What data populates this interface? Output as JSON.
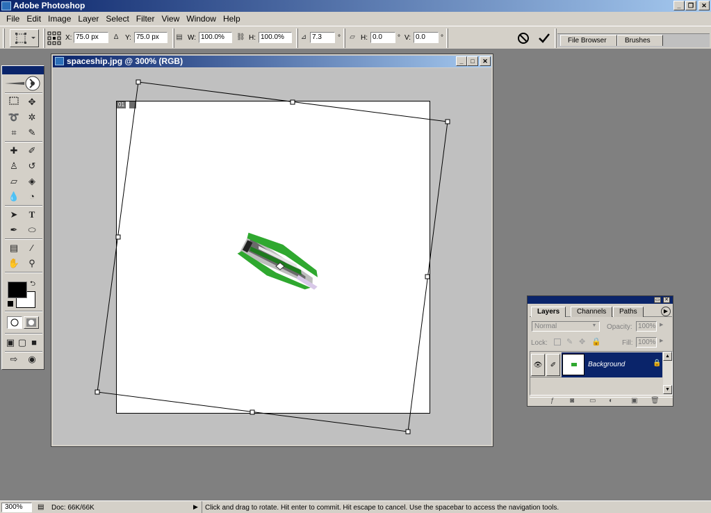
{
  "app": {
    "title": "Adobe Photoshop",
    "window_buttons": [
      "_",
      "❐",
      "✕"
    ]
  },
  "menu": [
    "File",
    "Edit",
    "Image",
    "Layer",
    "Select",
    "Filter",
    "View",
    "Window",
    "Help"
  ],
  "options": {
    "x_label": "X:",
    "x_value": "75.0 px",
    "y_label": "Y:",
    "y_value": "75.0 px",
    "w_label": "W:",
    "w_value": "100.0%",
    "h_label": "H:",
    "h_value": "100.0%",
    "angle_value": "7.3",
    "angle_unit": "°",
    "skew_h_label": "H:",
    "skew_h_value": "0.0",
    "skew_h_unit": "°",
    "skew_v_label": "V:",
    "skew_v_value": "0.0",
    "skew_v_unit": "°"
  },
  "palette_well": {
    "tabs": [
      "File Browser",
      "Brushes"
    ]
  },
  "document": {
    "title": "spaceship.jpg @ 300% (RGB)",
    "slice_label": "01"
  },
  "layers_panel": {
    "tabs": [
      "Layers",
      "Channels",
      "Paths"
    ],
    "blend_mode": "Normal",
    "opacity_label": "Opacity:",
    "opacity_value": "100%",
    "lock_label": "Lock:",
    "fill_label": "Fill:",
    "fill_value": "100%",
    "layers": [
      {
        "name": "Background"
      }
    ]
  },
  "status": {
    "zoom": "300%",
    "doc_size": "Doc: 66K/66K",
    "message": "Click and drag to rotate. Hit enter to commit. Hit escape to cancel. Use the spacebar to access the navigation tools."
  },
  "colors": {
    "titlebar_start": "#0a246a",
    "titlebar_end": "#a6caf0",
    "chrome": "#d4d0c8",
    "workspace": "#808080",
    "foreground_color": "#000000",
    "background_color": "#ffffff",
    "selected_layer": "#0a246a",
    "ship_green": "#2fa82f"
  }
}
